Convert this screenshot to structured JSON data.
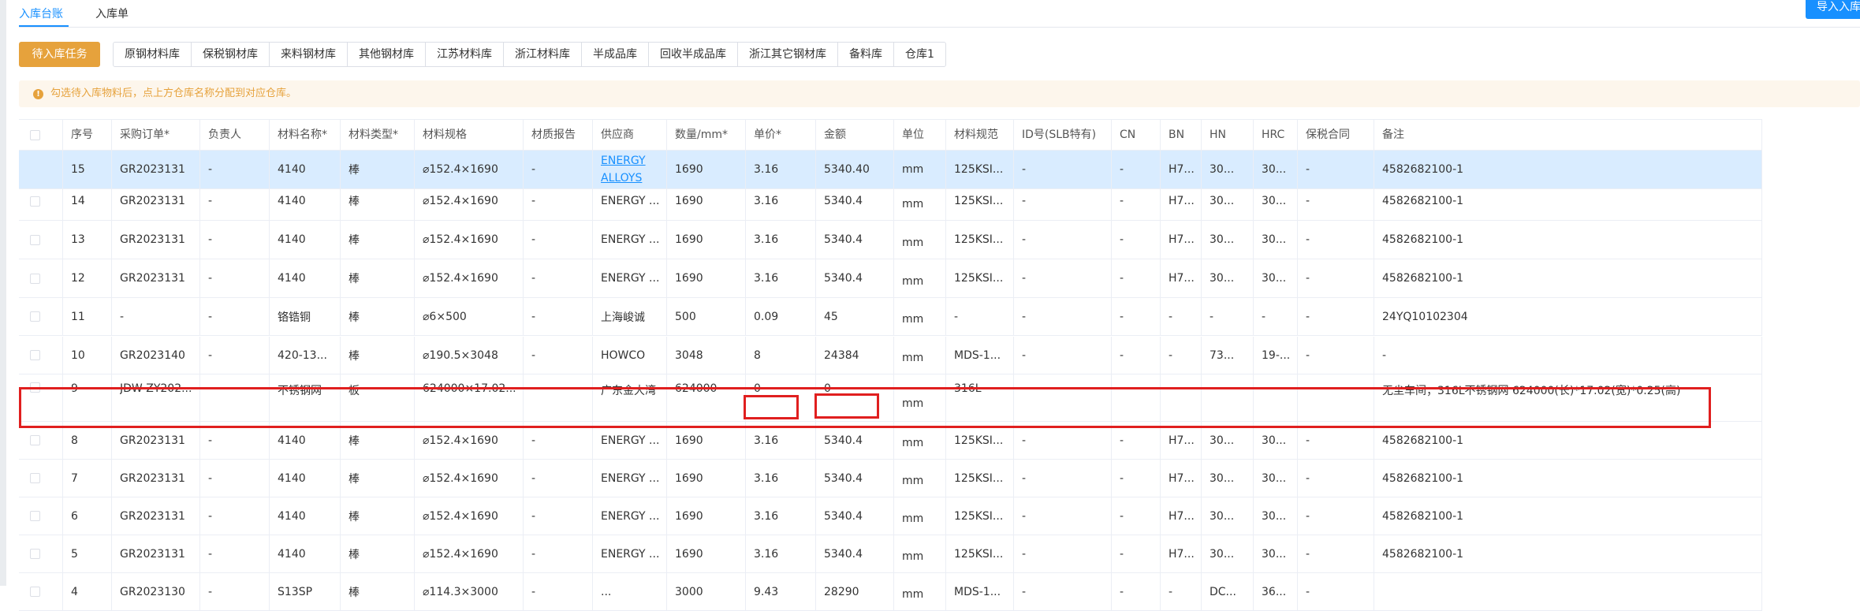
{
  "tabs": [
    {
      "label": "入库台账",
      "active": true
    },
    {
      "label": "入库单",
      "active": false
    }
  ],
  "import_button": "导入入库",
  "pending_button": "待入库任务",
  "warehouses": [
    "原钢材料库",
    "保税钢材库",
    "来料钢材库",
    "其他钢材库",
    "江苏材料库",
    "浙江材料库",
    "半成品库",
    "回收半成品库",
    "浙江其它钢材库",
    "备料库",
    "仓库1"
  ],
  "notice": {
    "icon": "warning-circle-icon",
    "text": "勾选待入库物料后，点上方仓库名称分配到对应仓库。"
  },
  "colors": {
    "accent": "#1890ff",
    "warning": "#e6a23c",
    "highlight": "#e01f1f",
    "selected_row": "#d9ecff"
  },
  "table": {
    "columns": [
      "",
      "序号",
      "采购订单*",
      "负责人",
      "材料名称*",
      "材料类型*",
      "材料规格",
      "材质报告",
      "供应商",
      "数量/mm*",
      "单价*",
      "金额",
      "单位",
      "材料规范",
      "ID号(SLB特有)",
      "CN",
      "BN",
      "HN",
      "HRC",
      "保税合同",
      "备注"
    ],
    "rows": [
      [
        "",
        "15",
        "GR2023131",
        "-",
        "4140",
        "棒",
        "⌀152.4×1690",
        "-",
        "ENERGY ALLOYS",
        "1690",
        "3.16",
        "5340.40",
        "mm",
        "125KSI...",
        "-",
        "-",
        "H7...",
        "30...",
        "30...",
        "-",
        "4582682100-1"
      ],
      [
        "",
        "14",
        "GR2023131",
        "-",
        "4140",
        "棒",
        "⌀152.4×1690",
        "-",
        "ENERGY ...",
        "1690",
        "3.16",
        "5340.4",
        "mm",
        "125KSI...",
        "-",
        "-",
        "H7...",
        "30...",
        "30...",
        "-",
        "4582682100-1"
      ],
      [
        "",
        "13",
        "GR2023131",
        "-",
        "4140",
        "棒",
        "⌀152.4×1690",
        "-",
        "ENERGY ...",
        "1690",
        "3.16",
        "5340.4",
        "mm",
        "125KSI...",
        "-",
        "-",
        "H7...",
        "30...",
        "30...",
        "-",
        "4582682100-1"
      ],
      [
        "",
        "12",
        "GR2023131",
        "-",
        "4140",
        "棒",
        "⌀152.4×1690",
        "-",
        "ENERGY ...",
        "1690",
        "3.16",
        "5340.4",
        "mm",
        "125KSI...",
        "-",
        "-",
        "H7...",
        "30...",
        "30...",
        "-",
        "4582682100-1"
      ],
      [
        "",
        "11",
        "-",
        "-",
        "铬锆铜",
        "棒",
        "⌀6×500",
        "-",
        "上海峻诚",
        "500",
        "0.09",
        "45",
        "mm",
        "-",
        "-",
        "-",
        "-",
        "-",
        "-",
        "-",
        "24YQ10102304"
      ],
      [
        "",
        "10",
        "GR2023140",
        "-",
        "420-13...",
        "棒",
        "⌀190.5×3048",
        "-",
        "HOWCO",
        "3048",
        "8",
        "24384",
        "mm",
        "MDS-1...",
        "-",
        "-",
        "-",
        "73...",
        "19-...",
        "-",
        "-"
      ],
      [
        "",
        "9",
        "JDW-ZY202...",
        "-",
        "不锈钢网",
        "板",
        "624000×17.02...",
        "-",
        "广东金大湾",
        "624000",
        "0",
        "0",
        "mm",
        "316L",
        "-",
        "-",
        "-",
        "-",
        "-",
        "-",
        "无尘车间；316L不锈钢网 624000(长)*17.02(宽)*0.25(高)"
      ],
      [
        "",
        "8",
        "GR2023131",
        "-",
        "4140",
        "棒",
        "⌀152.4×1690",
        "-",
        "ENERGY ...",
        "1690",
        "3.16",
        "5340.4",
        "mm",
        "125KSI...",
        "-",
        "-",
        "H7...",
        "30...",
        "30...",
        "-",
        "4582682100-1"
      ],
      [
        "",
        "7",
        "GR2023131",
        "-",
        "4140",
        "棒",
        "⌀152.4×1690",
        "-",
        "ENERGY ...",
        "1690",
        "3.16",
        "5340.4",
        "mm",
        "125KSI...",
        "-",
        "-",
        "H7...",
        "30...",
        "30...",
        "-",
        "4582682100-1"
      ],
      [
        "",
        "6",
        "GR2023131",
        "-",
        "4140",
        "棒",
        "⌀152.4×1690",
        "-",
        "ENERGY ...",
        "1690",
        "3.16",
        "5340.4",
        "mm",
        "125KSI...",
        "-",
        "-",
        "H7...",
        "30...",
        "30...",
        "-",
        "4582682100-1"
      ],
      [
        "",
        "5",
        "GR2023131",
        "-",
        "4140",
        "棒",
        "⌀152.4×1690",
        "-",
        "ENERGY ...",
        "1690",
        "3.16",
        "5340.4",
        "mm",
        "125KSI...",
        "-",
        "-",
        "H7...",
        "30...",
        "30...",
        "-",
        "4582682100-1"
      ],
      [
        "",
        "4",
        "GR2023130",
        "-",
        "S13SP",
        "棒",
        "⌀114.3×3000",
        "-",
        "...",
        "3000",
        "9.43",
        "28290",
        "mm",
        "MDS-1...",
        "-",
        "-",
        "-",
        "DC...",
        "36...",
        "-",
        ""
      ]
    ]
  }
}
